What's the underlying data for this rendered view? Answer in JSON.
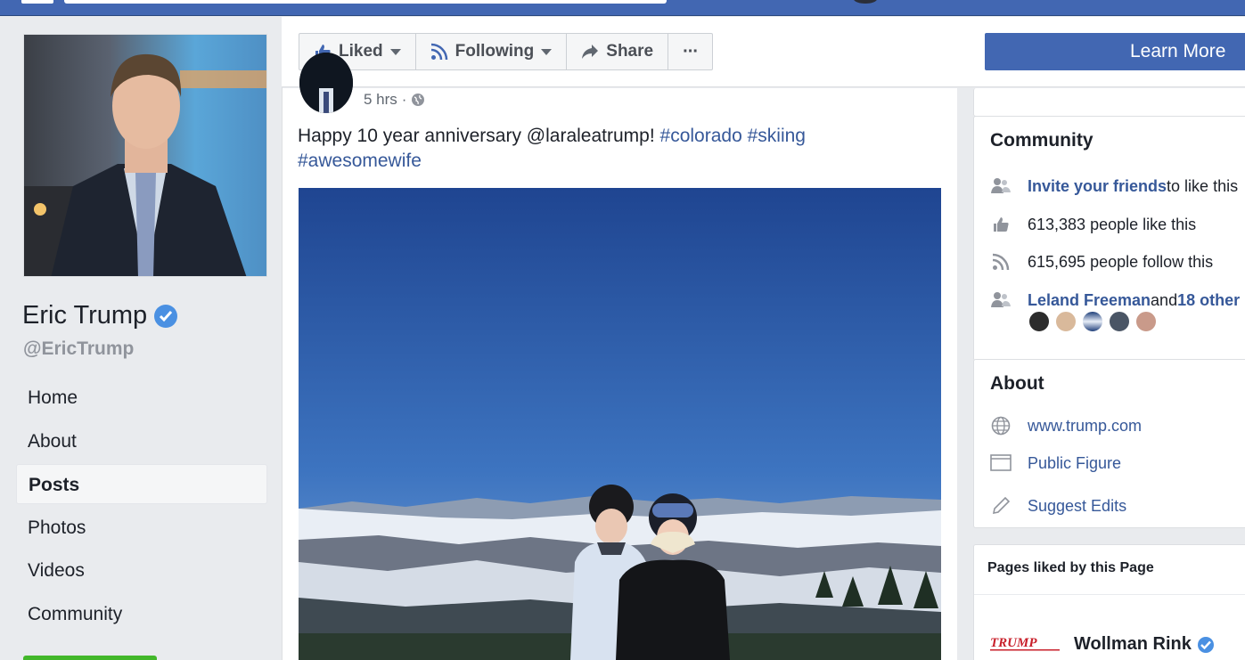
{
  "profile": {
    "name": "Eric Trump",
    "handle": "@EricTrump"
  },
  "nav": {
    "items": [
      {
        "label": "Home",
        "active": false
      },
      {
        "label": "About",
        "active": false
      },
      {
        "label": "Posts",
        "active": true
      },
      {
        "label": "Photos",
        "active": false
      },
      {
        "label": "Videos",
        "active": false
      },
      {
        "label": "Community",
        "active": false
      }
    ]
  },
  "actions": {
    "liked": "Liked",
    "following": "Following",
    "share": "Share",
    "more": "···",
    "learn_more": "Learn More"
  },
  "post": {
    "time": "5 hrs",
    "separator": "·",
    "text_plain": "Happy 10 year anniversary @laraleatrump! ",
    "tag1": "#colorado",
    "tag2": "#skiing",
    "tag3": "#awesomewife"
  },
  "community": {
    "title": "Community",
    "invite_link": "Invite your friends",
    "invite_rest": " to like this",
    "likes": "613,383 people like this",
    "follows": "615,695 people follow this",
    "friend_name": "Leland Freeman",
    "friend_and": " and ",
    "friend_others": "18 other"
  },
  "about": {
    "title": "About",
    "website": "www.trump.com",
    "category": "Public Figure",
    "suggest": "Suggest Edits"
  },
  "pages_liked": {
    "title": "Pages liked by this Page",
    "logo_text": "TRUMP",
    "item_name": "Wollman Rink"
  },
  "colors": {
    "fb_blue": "#4267b2",
    "link": "#365899",
    "verified": "#4a90e2"
  }
}
